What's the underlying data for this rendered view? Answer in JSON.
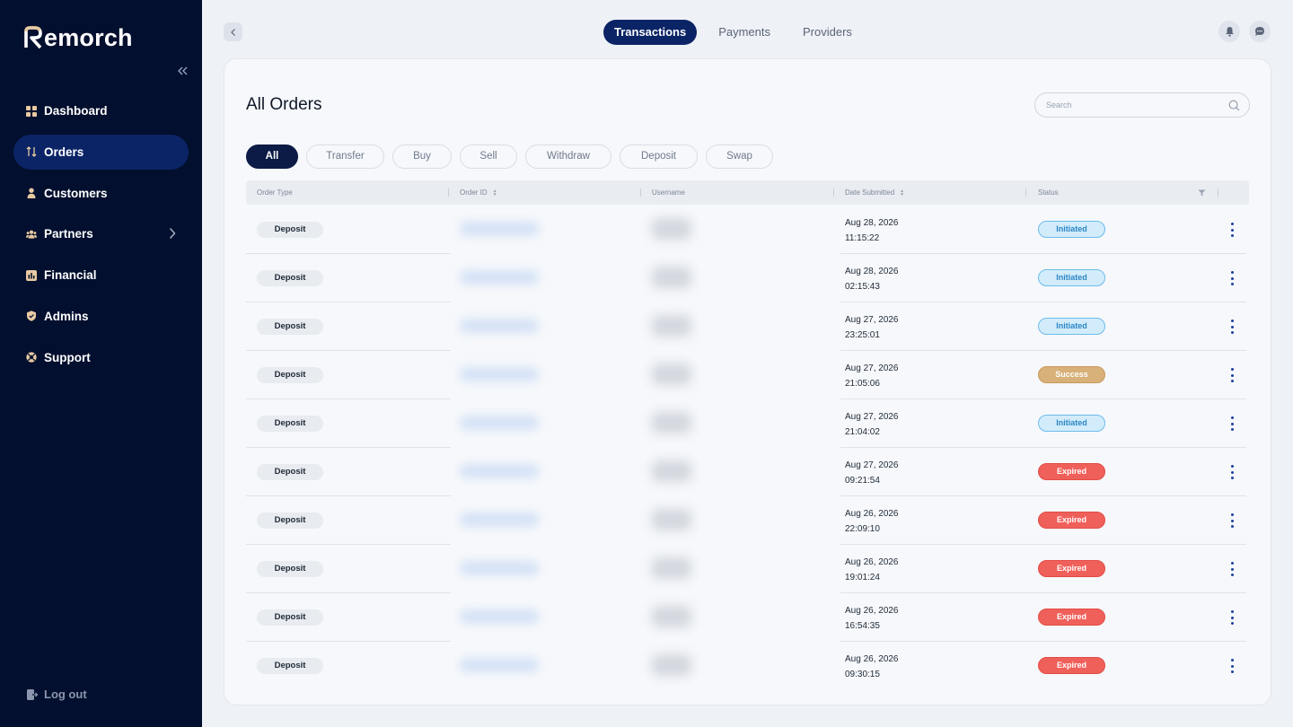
{
  "sidebar": {
    "logo_text": "emorch",
    "nav": [
      {
        "label": "Dashboard",
        "icon": "grid-icon",
        "active": false
      },
      {
        "label": "Orders",
        "icon": "swap-arrows-icon",
        "active": true
      },
      {
        "label": "Customers",
        "icon": "person-icon",
        "active": false
      },
      {
        "label": "Partners",
        "icon": "group-icon",
        "active": false,
        "has_submenu": true
      },
      {
        "label": "Financial",
        "icon": "chart-icon",
        "active": false
      },
      {
        "label": "Admins",
        "icon": "shield-icon",
        "active": false
      },
      {
        "label": "Support",
        "icon": "lifebuoy-icon",
        "active": false
      }
    ],
    "logout_label": "Log out"
  },
  "topbar": {
    "tabs": [
      {
        "label": "Transactions",
        "active": true
      },
      {
        "label": "Payments",
        "active": false
      },
      {
        "label": "Providers",
        "active": false
      }
    ]
  },
  "main": {
    "title": "All Orders",
    "search_placeholder": "Search",
    "filters": [
      {
        "label": "All",
        "active": true
      },
      {
        "label": "Transfer",
        "active": false
      },
      {
        "label": "Buy",
        "active": false
      },
      {
        "label": "Sell",
        "active": false
      },
      {
        "label": "Withdraw",
        "active": false
      },
      {
        "label": "Deposit",
        "active": false
      },
      {
        "label": "Swap",
        "active": false
      }
    ],
    "columns": [
      "Order Type",
      "Order ID",
      "Username",
      "Date Submitted",
      "Status"
    ],
    "rows": [
      {
        "type": "Deposit",
        "date": "Aug 28, 2026",
        "time": "11:15:22",
        "status": "Initiated"
      },
      {
        "type": "Deposit",
        "date": "Aug 28, 2026",
        "time": "02:15:43",
        "status": "Initiated"
      },
      {
        "type": "Deposit",
        "date": "Aug 27, 2026",
        "time": "23:25:01",
        "status": "Initiated"
      },
      {
        "type": "Deposit",
        "date": "Aug 27, 2026",
        "time": "21:05:06",
        "status": "Success"
      },
      {
        "type": "Deposit",
        "date": "Aug 27, 2026",
        "time": "21:04:02",
        "status": "Initiated"
      },
      {
        "type": "Deposit",
        "date": "Aug 27, 2026",
        "time": "09:21:54",
        "status": "Expired"
      },
      {
        "type": "Deposit",
        "date": "Aug 26, 2026",
        "time": "22:09:10",
        "status": "Expired"
      },
      {
        "type": "Deposit",
        "date": "Aug 26, 2026",
        "time": "19:01:24",
        "status": "Expired"
      },
      {
        "type": "Deposit",
        "date": "Aug 26, 2026",
        "time": "16:54:35",
        "status": "Expired"
      },
      {
        "type": "Deposit",
        "date": "Aug 26, 2026",
        "time": "09:30:15",
        "status": "Expired"
      }
    ]
  },
  "colors": {
    "sidebar_bg": "#030f2e",
    "accent": "#0b2466",
    "logo_accent": "#e8c9a2",
    "status_initiated": "#d2ecfb",
    "status_success": "#d8b079",
    "status_expired": "#f0605a"
  }
}
